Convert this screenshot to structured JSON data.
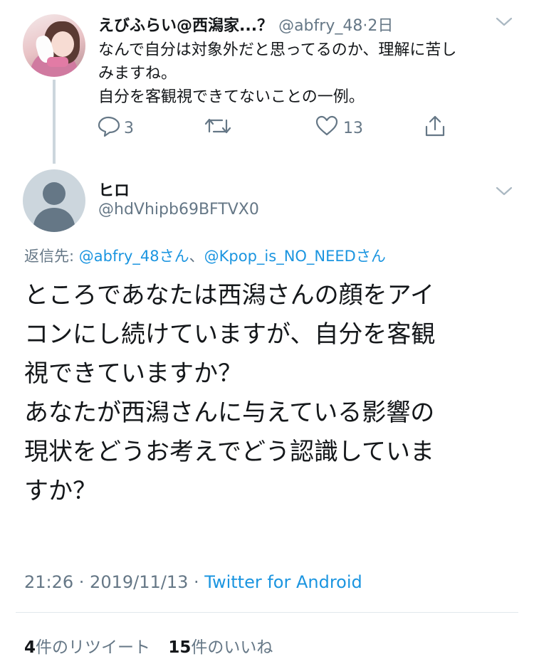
{
  "tweet1": {
    "display_name": "えびふらい@西潟家...？",
    "handle": "@abfry_48",
    "separator": "·",
    "time": "2日",
    "body_lines": [
      "なんで自分は対象外だと思ってるのか、理解に苦し",
      "みますね。",
      "自分を客観視できてないことの一例。"
    ],
    "reply_count": "3",
    "like_count": "13",
    "icons": [
      "reply-icon",
      "retweet-icon",
      "like-icon",
      "share-icon",
      "chevron-down-icon"
    ]
  },
  "tweet2": {
    "display_name": "ヒロ",
    "handle": "@hdVhipb69BFTVX0",
    "reply_prefix": "返信先: ",
    "reply_link1": "@abfry_48さん",
    "reply_sep": "、",
    "reply_link2": "@Kpop_is_NO_NEEDさん",
    "body_lines": [
      "ところであなたは西潟さんの顔をアイ",
      "コンにし続けていますが、自分を客観",
      "視できていますか？",
      "あなたが西潟さんに与えている影響の",
      "現状をどうお考えでどう認識していま",
      "すか？"
    ],
    "timestamp": "21:26 · 2019/11/13 · ",
    "source": "Twitter for Android",
    "retweet_count": "4",
    "retweet_label": "件のリツイート",
    "like_count": "15",
    "like_label": "件のいいね"
  },
  "colors": {
    "text_primary": "#14171a",
    "text_secondary": "#657786",
    "link": "#1b95e0",
    "divider": "#e1e8ed",
    "thread_line": "#ccd6dd"
  }
}
